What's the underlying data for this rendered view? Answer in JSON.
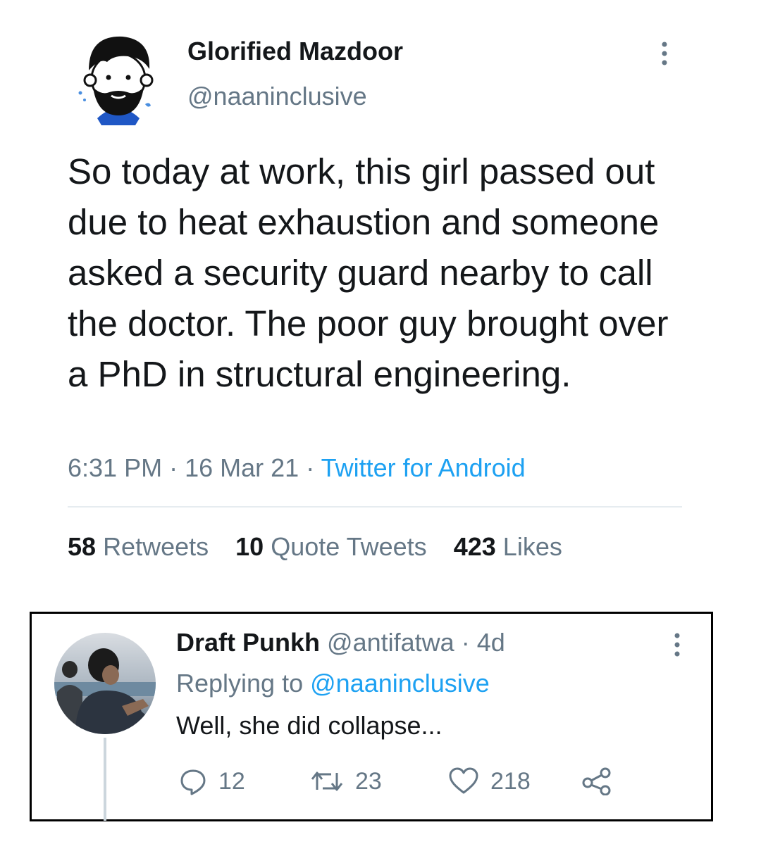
{
  "tweet": {
    "author_name": "Glorified Mazdoor",
    "author_handle": "@naaninclusive",
    "text": "So today at work, this girl passed out due to heat exhaustion and someone asked a security guard nearby to call the doctor. The poor guy brought over a PhD in structural engineering.",
    "time": "6:31 PM",
    "date": "16 Mar 21",
    "source": "Twitter for Android",
    "separator": "·",
    "more_icon": "more-vertical-icon"
  },
  "stats": {
    "retweets_count": "58",
    "retweets_label": "Retweets",
    "quotes_count": "10",
    "quotes_label": "Quote Tweets",
    "likes_count": "423",
    "likes_label": "Likes"
  },
  "reply": {
    "author_name": "Draft Punkh",
    "author_handle": "@antifatwa",
    "age": "4d",
    "replying_prefix": "Replying to",
    "replying_to": "@naaninclusive",
    "text": "Well, she did collapse...",
    "reply_count": "12",
    "retweet_count": "23",
    "like_count": "218",
    "icons": {
      "reply": "reply-bubble-icon",
      "retweet": "retweet-icon",
      "like": "heart-icon",
      "share": "share-icon"
    }
  },
  "colors": {
    "text": "#14171a",
    "secondary": "#657786",
    "link": "#1da1f2",
    "divider": "#e6ecf0"
  }
}
